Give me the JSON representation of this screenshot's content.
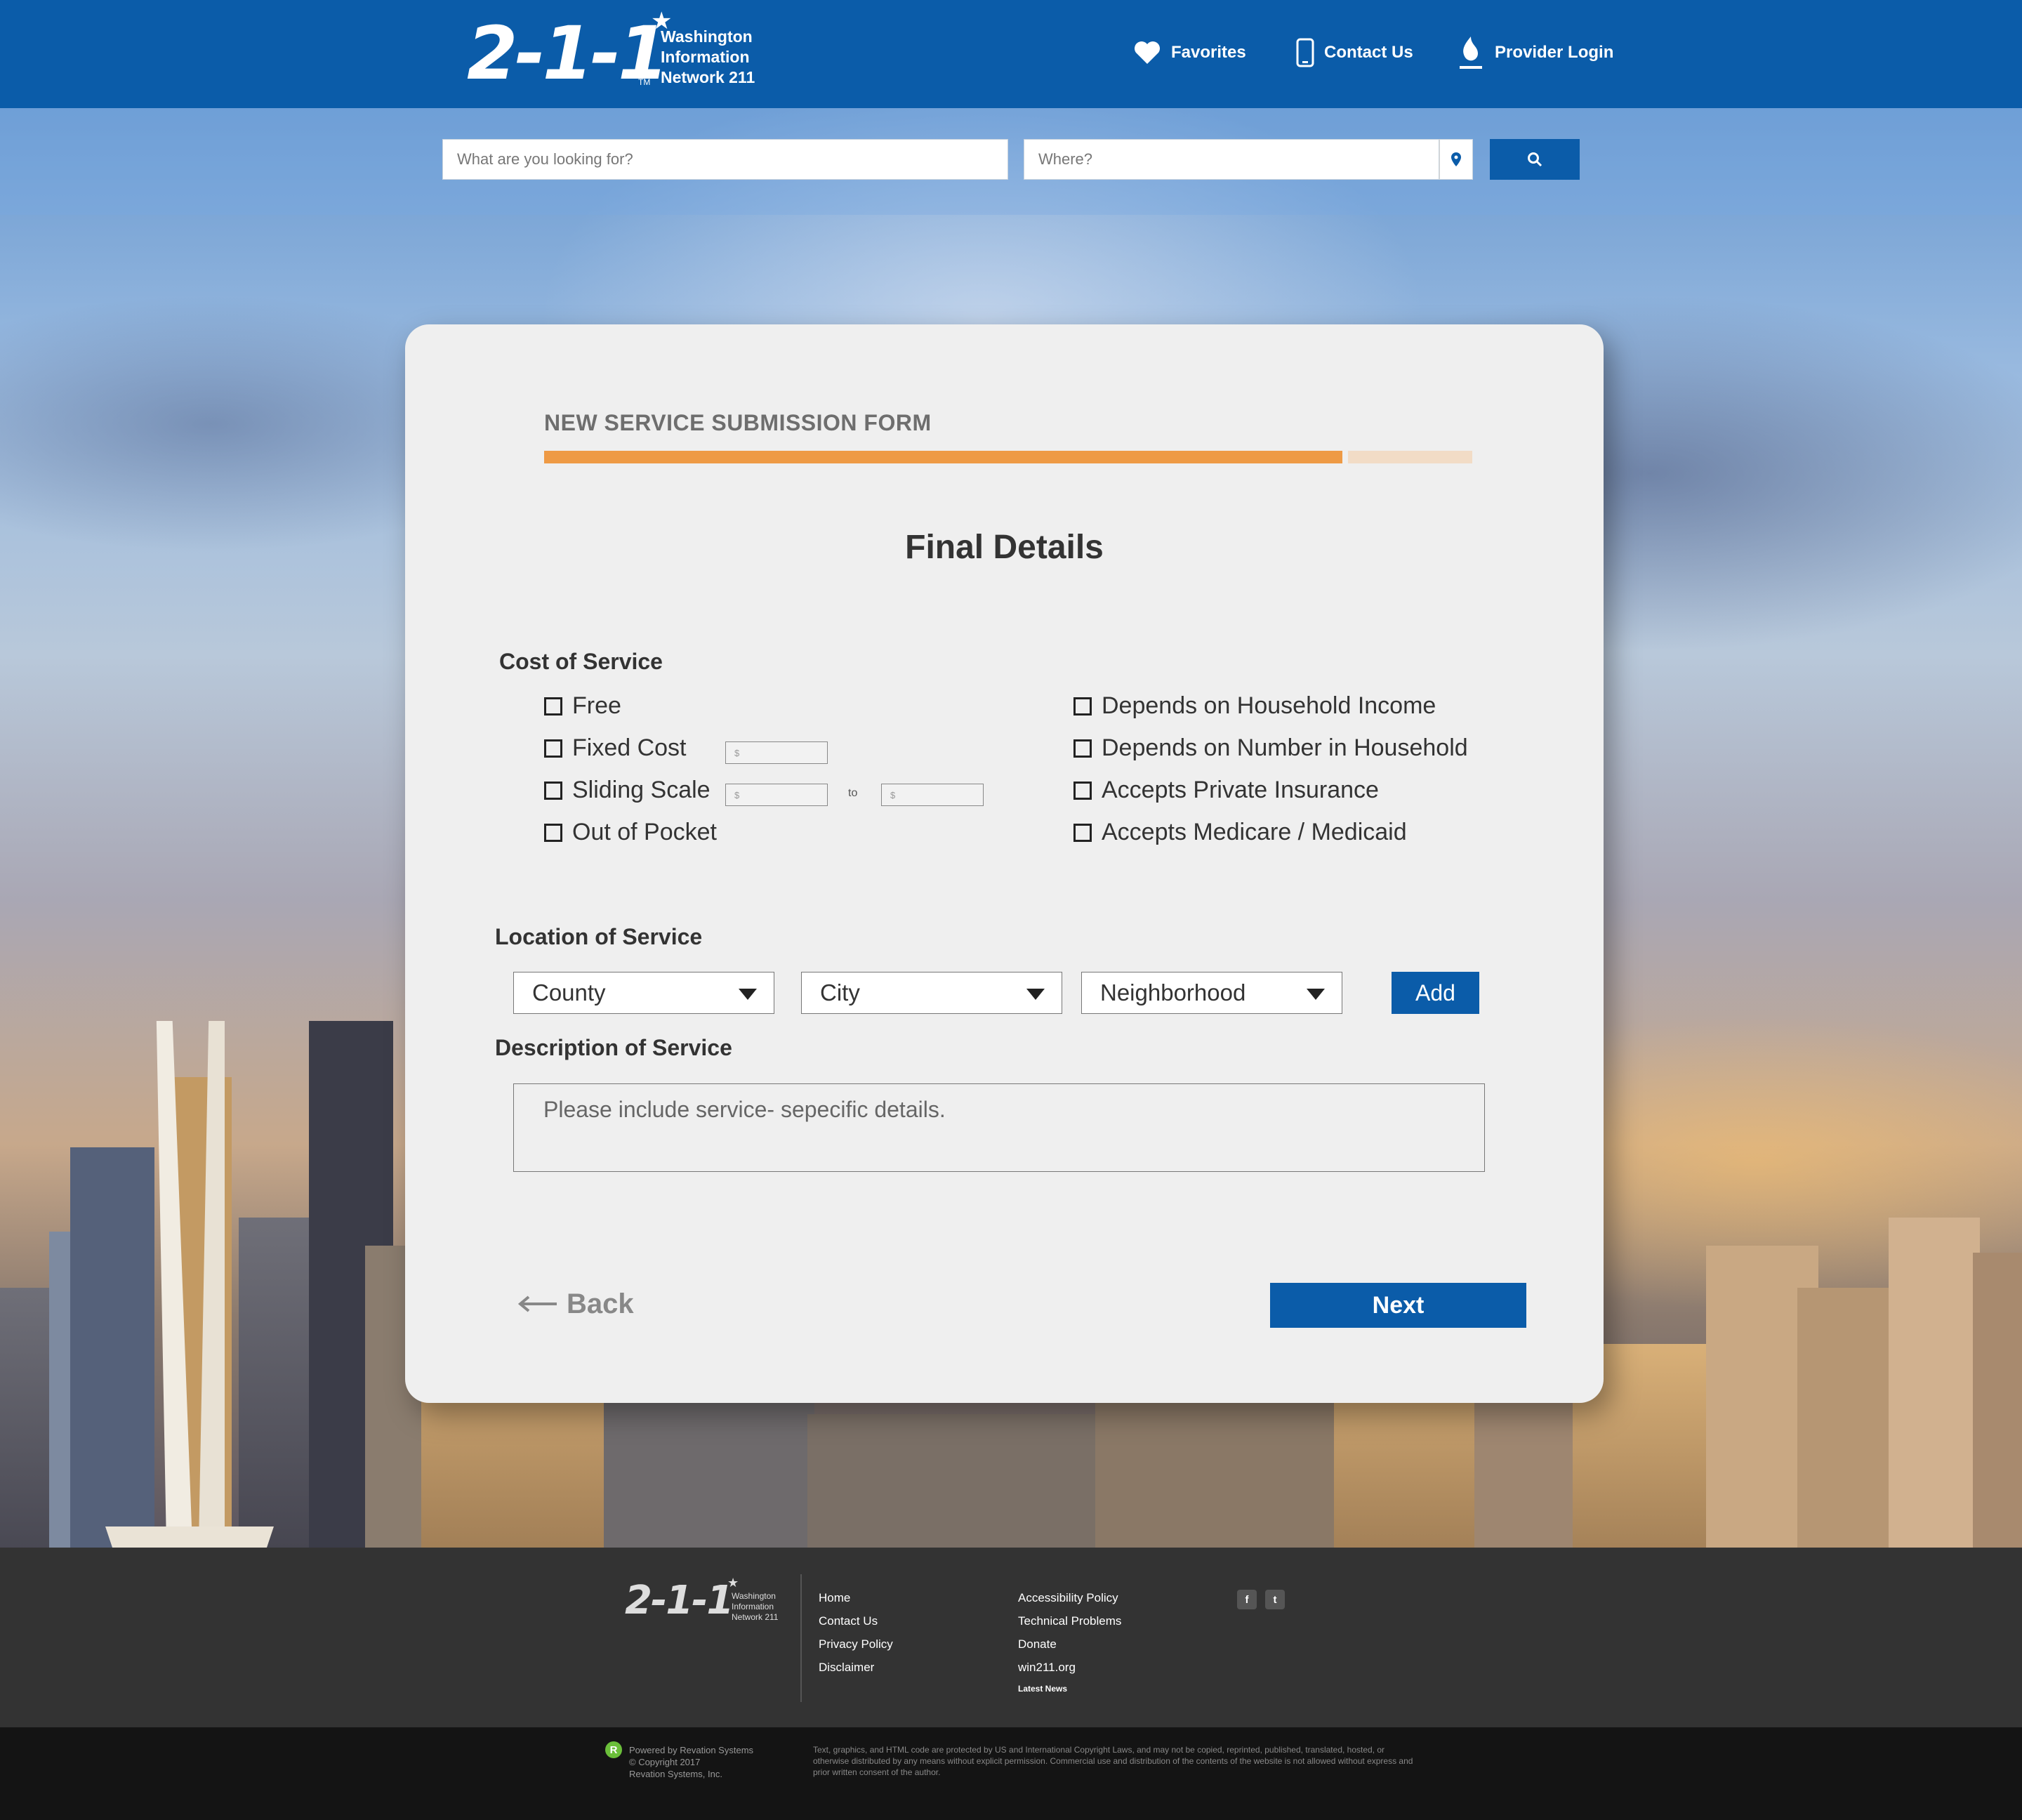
{
  "header": {
    "logo_number": "2-1-1",
    "logo_tm": "TM",
    "logo_line1": "Washington",
    "logo_line2": "Information",
    "logo_line3": "Network 211",
    "nav": {
      "favorites": "Favorites",
      "contact": "Contact Us",
      "provider_login": "Provider Login"
    }
  },
  "search": {
    "what_placeholder": "What are you looking for?",
    "where_placeholder": "Where?"
  },
  "form": {
    "title": "NEW SERVICE SUBMISSION FORM",
    "progress": 0.86,
    "heading": "Final Details",
    "cost": {
      "label": "Cost of Service",
      "left": [
        "Free",
        "Fixed Cost",
        "Sliding Scale",
        "Out of Pocket"
      ],
      "right": [
        "Depends on Household Income",
        "Depends on Number in Household",
        "Accepts Private Insurance",
        "Accepts Medicare / Medicaid"
      ],
      "money_placeholder": "$",
      "to": "to"
    },
    "location": {
      "label": "Location of Service",
      "county": "County",
      "city": "City",
      "neighborhood": "Neighborhood",
      "add": "Add"
    },
    "description": {
      "label": "Description of Service",
      "placeholder": "Please include service- sepecific details."
    },
    "back": "Back",
    "next": "Next"
  },
  "footer": {
    "links_col1": [
      "Home",
      "Contact Us",
      "Privacy Policy",
      "Disclaimer"
    ],
    "links_col2": [
      "Accessibility Policy",
      "Technical Problems",
      "Donate",
      "win211.org"
    ],
    "latest_news": "Latest News",
    "social": [
      "f",
      "t"
    ],
    "powered_line1": "Powered by Revation Systems",
    "powered_line2": "© Copyright 2017",
    "powered_line3": "Revation Systems, Inc.",
    "legal": "Text, graphics, and HTML code are protected by US and International Copyright Laws, and may not be copied, reprinted, published, translated, hosted, or otherwise distributed by any means without explicit permission. Commercial use and distribution of the contents of the website is not allowed without express and prior written consent of the author."
  },
  "colors": {
    "brand_blue": "#0b5ca9",
    "progress_orange": "#ee9a45",
    "progress_rest": "#f2dcc6"
  }
}
